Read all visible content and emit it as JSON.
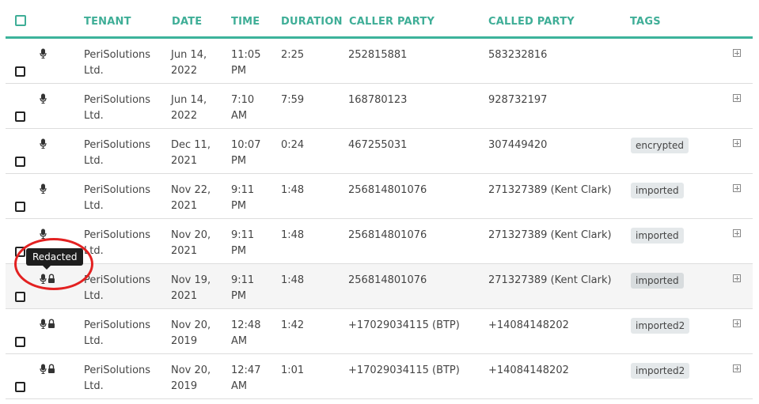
{
  "columns": {
    "tenant": "TENANT",
    "date": "DATE",
    "time": "TIME",
    "duration": "DURATION",
    "caller": "CALLER PARTY",
    "called": "CALLED PARTY",
    "tags": "TAGS"
  },
  "rows": [
    {
      "tenant1": "PeriSolutions",
      "tenant2": "Ltd.",
      "date1": "Jun 14,",
      "date2": "2022",
      "time1": "11:05",
      "time2": "PM",
      "duration": "2:25",
      "caller": "252815881",
      "called": "583232816",
      "tag": ""
    },
    {
      "tenant1": "PeriSolutions",
      "tenant2": "Ltd.",
      "date1": "Jun 14,",
      "date2": "2022",
      "time1": "7:10",
      "time2": "AM",
      "duration": "7:59",
      "caller": "168780123",
      "called": "928732197",
      "tag": ""
    },
    {
      "tenant1": "PeriSolutions",
      "tenant2": "Ltd.",
      "date1": "Dec 11,",
      "date2": "2021",
      "time1": "10:07",
      "time2": "PM",
      "duration": "0:24",
      "caller": "467255031",
      "called": "307449420",
      "tag": "encrypted"
    },
    {
      "tenant1": "PeriSolutions",
      "tenant2": "Ltd.",
      "date1": "Nov 22,",
      "date2": "2021",
      "time1": "9:11",
      "time2": "PM",
      "duration": "1:48",
      "caller": "256814801076",
      "called": "271327389 (Kent Clark)",
      "tag": "imported"
    },
    {
      "tenant1": "PeriSolutions",
      "tenant2": "Ltd.",
      "date1": "Nov 20,",
      "date2": "2021",
      "time1": "9:11",
      "time2": "PM",
      "duration": "1:48",
      "caller": "256814801076",
      "called": "271327389 (Kent Clark)",
      "tag": "imported"
    },
    {
      "tenant1": "PeriSolutions",
      "tenant2": "Ltd.",
      "date1": "Nov 19,",
      "date2": "2021",
      "time1": "9:11",
      "time2": "PM",
      "duration": "1:48",
      "caller": "256814801076",
      "called": "271327389 (Kent Clark)",
      "tag": "imported"
    },
    {
      "tenant1": "PeriSolutions",
      "tenant2": "Ltd.",
      "date1": "Nov 20,",
      "date2": "2019",
      "time1": "12:48",
      "time2": "AM",
      "duration": "1:42",
      "caller": "+17029034115 (BTP)",
      "called": "+14084148202",
      "tag": "imported2"
    },
    {
      "tenant1": "PeriSolutions",
      "tenant2": "Ltd.",
      "date1": "Nov 20,",
      "date2": "2019",
      "time1": "12:47",
      "time2": "AM",
      "duration": "1:01",
      "caller": "+17029034115 (BTP)",
      "called": "+14084148202",
      "tag": "imported2"
    }
  ],
  "tooltip": "Redacted",
  "icons": {
    "recording": "microphone-icon",
    "locked": "lock-icon",
    "expand": "expand-plus-icon"
  },
  "colors": {
    "accent": "#3fae97",
    "annotation": "#e32121"
  }
}
